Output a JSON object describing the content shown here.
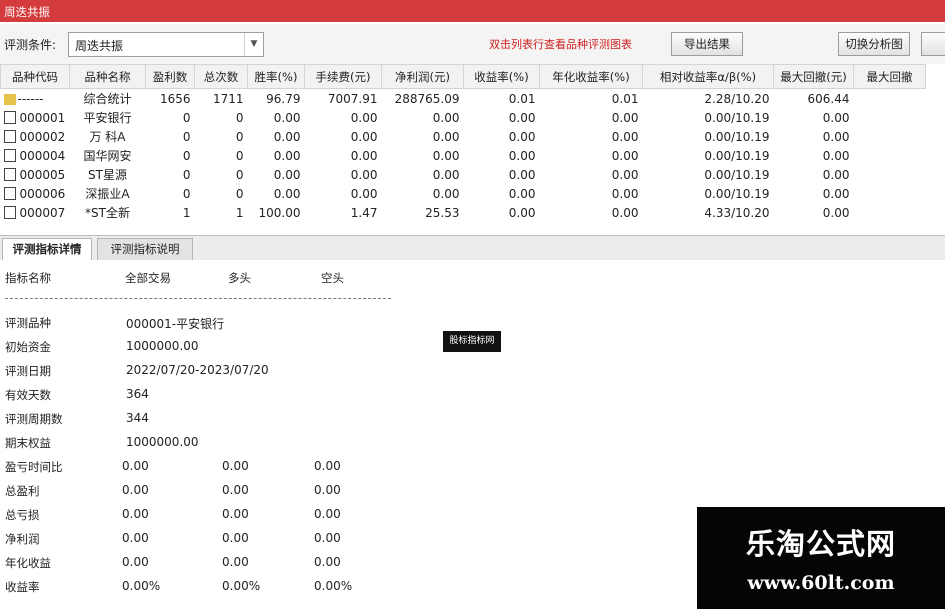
{
  "window": {
    "title": "周迭共振"
  },
  "toolbar": {
    "condition_label": "评测条件:",
    "condition_value": "周迭共振",
    "hint": "双击列表行查看品种评测图表",
    "export_button": "导出结果",
    "switch_button": "切换分析图"
  },
  "grid": {
    "headers": [
      "品种代码",
      "品种名称",
      "盈利数",
      "总次数",
      "胜率(%)",
      "手续费(元)",
      "净利润(元)",
      "收益率(%)",
      "年化收益率(%)",
      "相对收益率α/β(%)",
      "最大回撤(元)",
      "最大回撤"
    ],
    "rows": [
      {
        "code": "------",
        "name": "综合统计",
        "win": "1656",
        "total": "1711",
        "rate": "96.79",
        "fee": "7007.91",
        "net": "288765.09",
        "ret": "0.01",
        "annual": "0.01",
        "rel": "2.28/10.20",
        "dd": "606.44",
        "summary": true
      },
      {
        "code": "000001",
        "name": "平安银行",
        "win": "0",
        "total": "0",
        "rate": "0.00",
        "fee": "0.00",
        "net": "0.00",
        "ret": "0.00",
        "annual": "0.00",
        "rel": "0.00/10.19",
        "dd": "0.00"
      },
      {
        "code": "000002",
        "name": "万 科A",
        "win": "0",
        "total": "0",
        "rate": "0.00",
        "fee": "0.00",
        "net": "0.00",
        "ret": "0.00",
        "annual": "0.00",
        "rel": "0.00/10.19",
        "dd": "0.00"
      },
      {
        "code": "000004",
        "name": "国华网安",
        "win": "0",
        "total": "0",
        "rate": "0.00",
        "fee": "0.00",
        "net": "0.00",
        "ret": "0.00",
        "annual": "0.00",
        "rel": "0.00/10.19",
        "dd": "0.00"
      },
      {
        "code": "000005",
        "name": "ST星源",
        "win": "0",
        "total": "0",
        "rate": "0.00",
        "fee": "0.00",
        "net": "0.00",
        "ret": "0.00",
        "annual": "0.00",
        "rel": "0.00/10.19",
        "dd": "0.00"
      },
      {
        "code": "000006",
        "name": "深振业A",
        "win": "0",
        "total": "0",
        "rate": "0.00",
        "fee": "0.00",
        "net": "0.00",
        "ret": "0.00",
        "annual": "0.00",
        "rel": "0.00/10.19",
        "dd": "0.00"
      },
      {
        "code": "000007",
        "name": "*ST全新",
        "win": "1",
        "total": "1",
        "rate": "100.00",
        "fee": "1.47",
        "net": "25.53",
        "ret": "0.00",
        "annual": "0.00",
        "rel": "4.33/10.20",
        "dd": "0.00"
      }
    ]
  },
  "tabs": {
    "detail": "评测指标详情",
    "explain": "评测指标说明"
  },
  "detail": {
    "col_name": "指标名称",
    "col_all": "全部交易",
    "col_long": "多头",
    "col_short": "空头",
    "rows": [
      {
        "k": "评测品种",
        "v": "000001-平安银行"
      },
      {
        "k": "初始资金",
        "v": "1000000.00"
      },
      {
        "k": "评测日期",
        "v": "2022/07/20-2023/07/20"
      },
      {
        "k": "有效天数",
        "v": "364"
      },
      {
        "k": "评测周期数",
        "v": "344"
      },
      {
        "k": "期末权益",
        "v": "1000000.00"
      },
      {
        "k": "盈亏时间比",
        "all": "0.00",
        "long": "0.00",
        "short": "0.00"
      },
      {
        "k": "总盈利",
        "all": "0.00",
        "long": "0.00",
        "short": "0.00"
      },
      {
        "k": "总亏损",
        "all": "0.00",
        "long": "0.00",
        "short": "0.00"
      },
      {
        "k": "净利润",
        "all": "0.00",
        "long": "0.00",
        "short": "0.00"
      },
      {
        "k": "年化收益",
        "all": "0.00",
        "long": "0.00",
        "short": "0.00"
      },
      {
        "k": "收益率",
        "all": "0.00%",
        "long": "0.00%",
        "short": "0.00%"
      }
    ]
  },
  "stamp": "股标指标网",
  "watermark": {
    "cn": "乐淘公式网",
    "url": "www.60lt.com"
  }
}
